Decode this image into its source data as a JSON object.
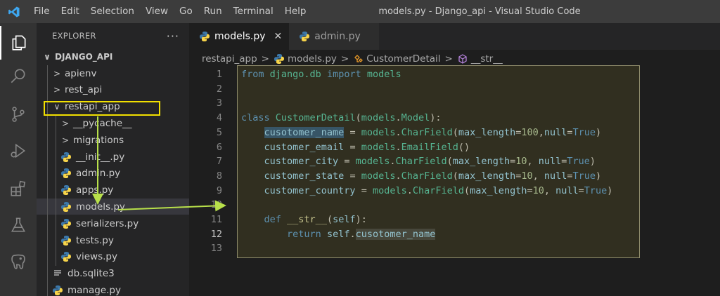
{
  "app": {
    "window_title": "models.py - Django_api - Visual Studio Code",
    "menu": [
      "File",
      "Edit",
      "Selection",
      "View",
      "Go",
      "Run",
      "Terminal",
      "Help"
    ]
  },
  "explorer": {
    "header": "EXPLORER",
    "more": "···",
    "root": "DJANGO_API",
    "items": [
      {
        "label": "apienv",
        "type": "folder",
        "chev": ">",
        "depth": 1
      },
      {
        "label": "rest_api",
        "type": "folder",
        "chev": ">",
        "depth": 1
      },
      {
        "label": "restapi_app",
        "type": "folder",
        "chev": "∨",
        "depth": 1
      },
      {
        "label": "__pycache__",
        "type": "folder",
        "chev": ">",
        "depth": 2
      },
      {
        "label": "migrations",
        "type": "folder",
        "chev": ">",
        "depth": 2
      },
      {
        "label": "__init__.py",
        "type": "py",
        "depth": 2
      },
      {
        "label": "admin.py",
        "type": "py",
        "depth": 2
      },
      {
        "label": "apps.py",
        "type": "py",
        "depth": 2
      },
      {
        "label": "models.py",
        "type": "py",
        "depth": 2,
        "selected": true
      },
      {
        "label": "serializers.py",
        "type": "py",
        "depth": 2
      },
      {
        "label": "tests.py",
        "type": "py",
        "depth": 2
      },
      {
        "label": "views.py",
        "type": "py",
        "depth": 2
      },
      {
        "label": "db.sqlite3",
        "type": "db",
        "depth": 1
      },
      {
        "label": "manage.py",
        "type": "py",
        "depth": 1
      }
    ]
  },
  "tabs": [
    {
      "label": "models.py",
      "active": true,
      "close": "✕"
    },
    {
      "label": "admin.py",
      "active": false
    }
  ],
  "breadcrumb": [
    "restapi_app",
    "models.py",
    "CustomerDetail",
    "__str__"
  ],
  "editor": {
    "current_line": 12,
    "lines": [
      {
        "n": "1",
        "tokens": [
          [
            "kw",
            "from"
          ],
          [
            "plain",
            " "
          ],
          [
            "mod",
            "django.db"
          ],
          [
            "plain",
            " "
          ],
          [
            "kw",
            "import"
          ],
          [
            "plain",
            " "
          ],
          [
            "mod",
            "models"
          ]
        ]
      },
      {
        "n": "2",
        "tokens": []
      },
      {
        "n": "3",
        "tokens": []
      },
      {
        "n": "4",
        "tokens": [
          [
            "kw",
            "class"
          ],
          [
            "plain",
            " "
          ],
          [
            "mod",
            "CustomerDetail"
          ],
          [
            "plain",
            "("
          ],
          [
            "mod",
            "models"
          ],
          [
            "plain",
            "."
          ],
          [
            "mod",
            "Model"
          ],
          [
            "plain",
            "):"
          ]
        ]
      },
      {
        "n": "5",
        "tokens": [
          [
            "plain",
            "    "
          ],
          [
            "var hl",
            "cusotomer_name"
          ],
          [
            "plain",
            " = "
          ],
          [
            "mod",
            "models"
          ],
          [
            "plain",
            "."
          ],
          [
            "mod",
            "CharField"
          ],
          [
            "plain",
            "("
          ],
          [
            "var",
            "max_length"
          ],
          [
            "plain",
            "="
          ],
          [
            "num",
            "100"
          ],
          [
            "plain",
            ","
          ],
          [
            "var",
            "null"
          ],
          [
            "plain",
            "="
          ],
          [
            "kw",
            "True"
          ],
          [
            "plain",
            ")"
          ]
        ]
      },
      {
        "n": "6",
        "tokens": [
          [
            "plain",
            "    "
          ],
          [
            "var",
            "customer_email"
          ],
          [
            "plain",
            " = "
          ],
          [
            "mod",
            "models"
          ],
          [
            "plain",
            "."
          ],
          [
            "mod",
            "EmailField"
          ],
          [
            "plain",
            "()"
          ]
        ]
      },
      {
        "n": "7",
        "tokens": [
          [
            "plain",
            "    "
          ],
          [
            "var",
            "customer_city"
          ],
          [
            "plain",
            " = "
          ],
          [
            "mod",
            "models"
          ],
          [
            "plain",
            "."
          ],
          [
            "mod",
            "CharField"
          ],
          [
            "plain",
            "("
          ],
          [
            "var",
            "max_length"
          ],
          [
            "plain",
            "="
          ],
          [
            "num",
            "10"
          ],
          [
            "plain",
            ", "
          ],
          [
            "var",
            "null"
          ],
          [
            "plain",
            "="
          ],
          [
            "kw",
            "True"
          ],
          [
            "plain",
            ")"
          ]
        ]
      },
      {
        "n": "8",
        "tokens": [
          [
            "plain",
            "    "
          ],
          [
            "var",
            "customer_state"
          ],
          [
            "plain",
            " = "
          ],
          [
            "mod",
            "models"
          ],
          [
            "plain",
            "."
          ],
          [
            "mod",
            "CharField"
          ],
          [
            "plain",
            "("
          ],
          [
            "var",
            "max_length"
          ],
          [
            "plain",
            "="
          ],
          [
            "num",
            "10"
          ],
          [
            "plain",
            ", "
          ],
          [
            "var",
            "null"
          ],
          [
            "plain",
            "="
          ],
          [
            "kw",
            "True"
          ],
          [
            "plain",
            ")"
          ]
        ]
      },
      {
        "n": "9",
        "tokens": [
          [
            "plain",
            "    "
          ],
          [
            "var",
            "customer_country"
          ],
          [
            "plain",
            " = "
          ],
          [
            "mod",
            "models"
          ],
          [
            "plain",
            "."
          ],
          [
            "mod",
            "CharField"
          ],
          [
            "plain",
            "("
          ],
          [
            "var",
            "max_length"
          ],
          [
            "plain",
            "="
          ],
          [
            "num",
            "10"
          ],
          [
            "plain",
            ", "
          ],
          [
            "var",
            "null"
          ],
          [
            "plain",
            "="
          ],
          [
            "kw",
            "True"
          ],
          [
            "plain",
            ")"
          ]
        ]
      },
      {
        "n": "10",
        "tokens": []
      },
      {
        "n": "11",
        "tokens": [
          [
            "plain",
            "    "
          ],
          [
            "kw",
            "def"
          ],
          [
            "plain",
            " "
          ],
          [
            "fn",
            "__str__"
          ],
          [
            "plain",
            "("
          ],
          [
            "var",
            "self"
          ],
          [
            "plain",
            "):"
          ]
        ]
      },
      {
        "n": "12",
        "tokens": [
          [
            "plain",
            "        "
          ],
          [
            "kw",
            "return"
          ],
          [
            "plain",
            " "
          ],
          [
            "var",
            "self"
          ],
          [
            "plain",
            "."
          ],
          [
            "var hl2",
            "cusotomer_name"
          ]
        ]
      },
      {
        "n": "13",
        "tokens": []
      }
    ]
  },
  "colors": {
    "accent_annotation": "#f2e000",
    "arrow": "#b8e04a",
    "python_icon_blue": "#3c78aa",
    "python_icon_yellow": "#f7d44a"
  }
}
